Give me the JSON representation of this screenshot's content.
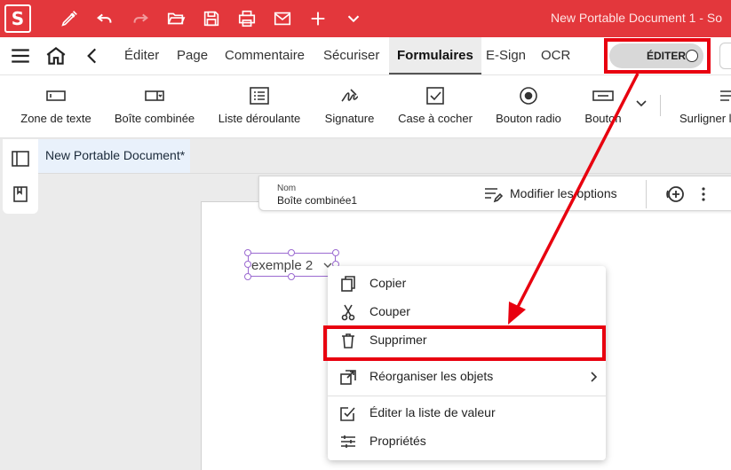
{
  "titlebar": {
    "logo": "S",
    "document_title": "New Portable Document 1  -  So",
    "quick_access_icons": [
      "pen-icon",
      "undo-icon",
      "redo-icon",
      "open-folder-icon",
      "save-icon",
      "print-icon",
      "mail-icon",
      "plus-icon",
      "chevron-down-icon"
    ]
  },
  "menubar": {
    "items": [
      {
        "label": "Éditer"
      },
      {
        "label": "Page"
      },
      {
        "label": "Commentaire"
      },
      {
        "label": "Sécuriser"
      },
      {
        "label": "Formulaires",
        "active": true
      },
      {
        "label": "E-Sign"
      },
      {
        "label": "OCR"
      }
    ],
    "edit_toggle_label": "ÉDITER"
  },
  "toolbar": {
    "tools": [
      {
        "label": "Zone de texte",
        "icon": "text-field-icon"
      },
      {
        "label": "Boîte combinée",
        "icon": "combo-box-icon"
      },
      {
        "label": "Liste déroulante",
        "icon": "list-box-icon"
      },
      {
        "label": "Signature",
        "icon": "signature-icon"
      },
      {
        "label": "Case à cocher",
        "icon": "checkbox-icon"
      },
      {
        "label": "Bouton radio",
        "icon": "radio-button-icon"
      },
      {
        "label": "Bouton",
        "icon": "button-icon"
      },
      {
        "label": "Surligner l",
        "icon": "highlight-fields-icon"
      }
    ]
  },
  "document": {
    "tab_label": "New Portable Document*"
  },
  "property_bar": {
    "name_label": "Nom",
    "name_value": "Boîte combinée1",
    "edit_options_label": "Modifier les options"
  },
  "field": {
    "value": "exemple 2"
  },
  "context_menu": {
    "items": [
      {
        "label": "Copier",
        "icon": "copy-icon"
      },
      {
        "label": "Couper",
        "icon": "scissors-icon"
      },
      {
        "label": "Supprimer",
        "icon": "trash-icon"
      },
      {
        "label": "Réorganiser les objets",
        "icon": "arrange-icon",
        "submenu": true
      },
      {
        "label": "Éditer la liste de valeur",
        "icon": "edit-list-icon"
      },
      {
        "label": "Propriétés",
        "icon": "properties-icon"
      }
    ]
  },
  "colors": {
    "accent": "#e3373c",
    "highlight": "#e8000f",
    "selection": "#9b6ad1"
  }
}
